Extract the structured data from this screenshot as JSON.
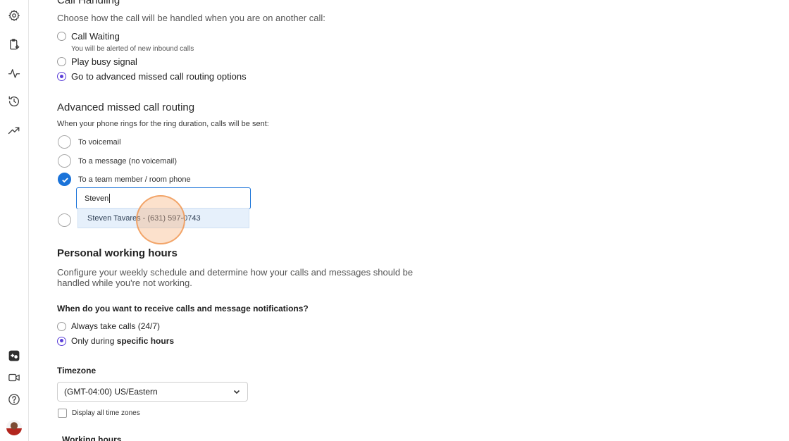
{
  "sidebar": {
    "icons": [
      "settings-icon",
      "clipboard-sparkle-icon",
      "activity-icon",
      "history-icon",
      "trending-icon",
      "ai-assistant-icon",
      "video-icon",
      "help-icon",
      "avatar"
    ]
  },
  "call_handling": {
    "heading": "Call Handling",
    "description": "Choose how the call will be handled when you are on another call:",
    "options": [
      {
        "label": "Call Waiting",
        "sub": "You will be alerted of new inbound calls",
        "selected": false
      },
      {
        "label": "Play busy signal",
        "selected": false
      },
      {
        "label": "Go to advanced missed call routing options",
        "selected": true
      }
    ]
  },
  "advanced_routing": {
    "heading": "Advanced missed call routing",
    "description": "When your phone rings for the ring duration, calls will be sent:",
    "options": [
      {
        "label": "To voicemail",
        "selected": false
      },
      {
        "label": "To a message (no voicemail)",
        "selected": false
      },
      {
        "label": "To a team member / room phone",
        "selected": true
      }
    ],
    "search_value": "Steven",
    "suggestion": "Steven Tavares - (631) 597-0743"
  },
  "working_hours": {
    "heading": "Personal working hours",
    "description_line1": "Configure your weekly schedule and determine how your calls and messages should be",
    "description_line2": "handled while you're not working.",
    "question": "When do you want to receive calls and message notifications?",
    "option_always": "Always take calls (24/7)",
    "option_specific_prefix": "Only during ",
    "option_specific_bold": "specific hours",
    "selected": "specific"
  },
  "timezone": {
    "label": "Timezone",
    "value": "(GMT-04:00) US/Eastern",
    "display_all_label": "Display all time zones",
    "display_all_checked": false
  },
  "working_hours_sub": {
    "label": "Working hours"
  },
  "colors": {
    "accent_purple": "#5b3fd8",
    "accent_blue": "#1a73d9",
    "suggestion_bg": "#e6f0fb"
  }
}
